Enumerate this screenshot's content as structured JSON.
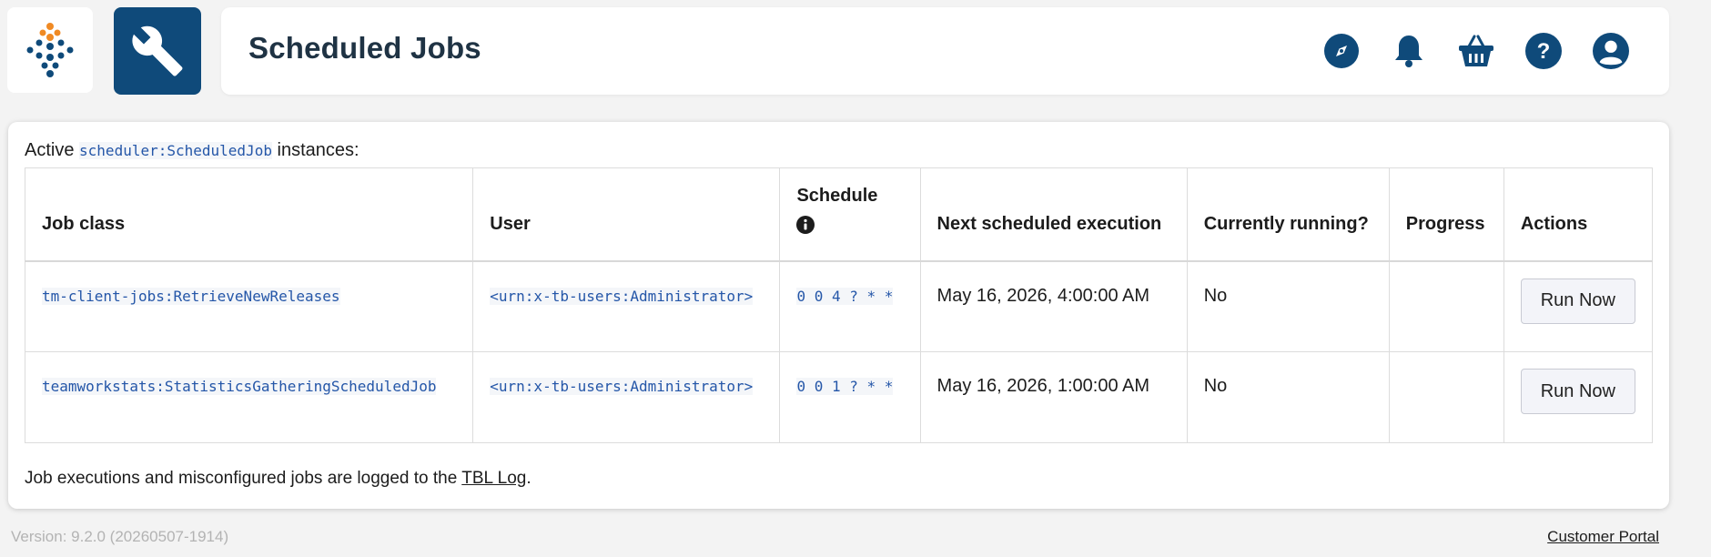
{
  "header": {
    "title": "Scheduled Jobs",
    "icons": [
      "compass-icon",
      "bell-icon",
      "basket-icon",
      "help-icon",
      "user-icon"
    ]
  },
  "colors": {
    "brand_blue": "#0f4a7a",
    "brand_orange": "#f08a24",
    "link_blue": "#2456a8"
  },
  "intro": {
    "prefix": "Active",
    "code": "scheduler:ScheduledJob",
    "suffix": "instances:"
  },
  "table": {
    "headers": {
      "job_class": "Job class",
      "user": "User",
      "schedule": "Schedule",
      "next_execution": "Next scheduled execution",
      "currently_running": "Currently running?",
      "progress": "Progress",
      "actions": "Actions"
    },
    "rows": [
      {
        "job_class": "tm-client-jobs:RetrieveNewReleases",
        "user": "<urn:x-tb-users:Administrator>",
        "schedule": "0 0 4 ? * *",
        "next_execution": "May 16, 2026, 4:00:00 AM",
        "running": "No",
        "progress": "",
        "action_label": "Run Now"
      },
      {
        "job_class": "teamworkstats:StatisticsGatheringScheduledJob",
        "user": "<urn:x-tb-users:Administrator>",
        "schedule": "0 0 1 ? * *",
        "next_execution": "May 16, 2026, 1:00:00 AM",
        "running": "No",
        "progress": "",
        "action_label": "Run Now"
      }
    ]
  },
  "footer_note": {
    "text": "Job executions and misconfigured jobs are logged to the",
    "link": "TBL Log",
    "end": "."
  },
  "version": "Version: 9.2.0 (20260507-1914)",
  "customer_portal": "Customer Portal"
}
